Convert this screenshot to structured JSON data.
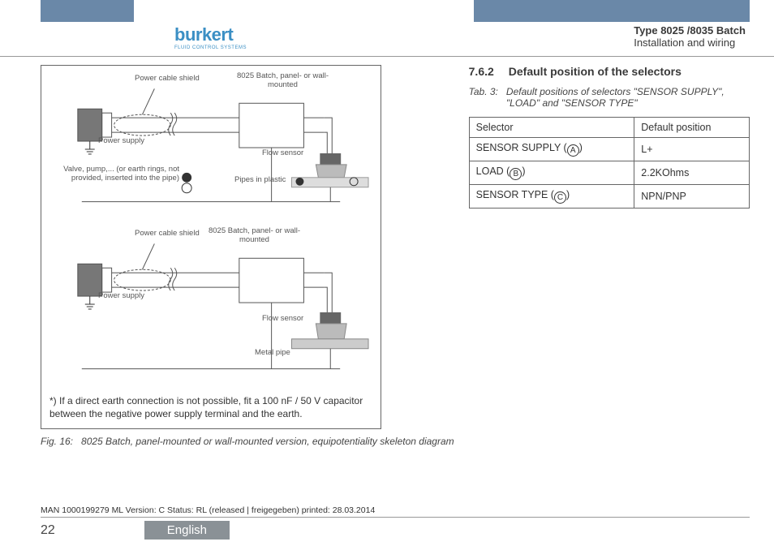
{
  "header": {
    "logo_text": "burkert",
    "logo_sub": "FLUID CONTROL SYSTEMS",
    "title_bold": "Type 8025 /8035 Batch",
    "title_sub": "Installation and wiring"
  },
  "figure": {
    "labels": {
      "power_cable_shield_1": "Power cable shield",
      "device_1": "8025 Batch, panel- or wall-mounted",
      "power_supply_1": "Power supply",
      "flow_sensor_1": "Flow sensor",
      "valve_text": "Valve, pump,... (or earth rings, not provided, inserted into the pipe)",
      "pipes_plastic": "Pipes in plastic",
      "power_cable_shield_2": "Power cable shield",
      "device_2": "8025 Batch, panel- or wall-mounted",
      "power_supply_2": "Power supply",
      "flow_sensor_2": "Flow sensor",
      "metal_pipe": "Metal pipe"
    },
    "footnote": "*) If a direct earth connection is not possible, fit a 100 nF / 50 V capacitor between the negative power supply terminal and the earth.",
    "caption_num": "Fig. 16:",
    "caption_text": "8025 Batch, panel-mounted or wall-mounted version, equipotentiality skeleton diagram"
  },
  "section": {
    "num": "7.6.2",
    "title": "Default position of the selectors",
    "tab_num": "Tab. 3:",
    "tab_text": "Default positions of selectors \"SENSOR SUPPLY\", \"LOAD\" and \"SENSOR TYPE\"",
    "table": {
      "head_selector": "Selector",
      "head_default": "Default position",
      "rows": [
        {
          "selector_pre": "SENSOR SUPPLY (",
          "letter": "A",
          "selector_post": ")",
          "value": "L+"
        },
        {
          "selector_pre": "LOAD (",
          "letter": "B",
          "selector_post": ")",
          "value": "2.2KOhms"
        },
        {
          "selector_pre": "SENSOR TYPE (",
          "letter": "C",
          "selector_post": ")",
          "value": "NPN/PNP"
        }
      ]
    }
  },
  "footer": {
    "meta": "MAN  1000199279  ML  Version: C Status: RL (released | freigegeben)  printed: 28.03.2014",
    "page": "22",
    "lang": "English"
  }
}
